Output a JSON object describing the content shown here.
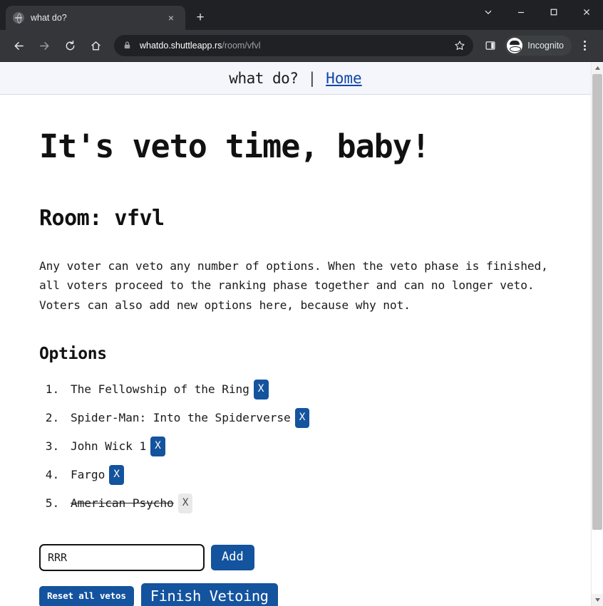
{
  "browser": {
    "tab": {
      "title": "what do?",
      "favicon": "globe-icon",
      "close_label": "×"
    },
    "new_tab_label": "+",
    "window_controls": {
      "tab_search": "chevron-down-icon",
      "minimize": "minimize-icon",
      "maximize": "maximize-icon",
      "close": "close-icon"
    },
    "nav": {
      "back": "back-arrow-icon",
      "forward": "forward-arrow-icon",
      "reload": "reload-icon",
      "home": "home-icon"
    },
    "omnibox": {
      "lock": "lock-icon",
      "url_host": "whatdo.shuttleapp.rs",
      "url_path": "/room/vfvl",
      "bookmark": "star-icon"
    },
    "side_panel": "side-panel-icon",
    "incognito": {
      "label": "Incognito",
      "icon": "incognito-icon"
    },
    "menu": "three-dot-menu-icon"
  },
  "site": {
    "brand": "what do?",
    "separator": "|",
    "home_link": "Home"
  },
  "page": {
    "title": "It's veto time, baby!",
    "room_heading": "Room: vfvl",
    "blurb": "Any voter can veto any number of options. When the veto phase is finished, all voters proceed to the ranking phase together and can no longer veto. Voters can also add new options here, because why not.",
    "options_heading": "Options",
    "options": [
      {
        "label": "The Fellowship of the Ring",
        "veto_label": "X",
        "vetoed": false
      },
      {
        "label": "Spider-Man: Into the Spiderverse",
        "veto_label": "X",
        "vetoed": false
      },
      {
        "label": "John Wick 1",
        "veto_label": "X",
        "vetoed": false
      },
      {
        "label": "Fargo",
        "veto_label": "X",
        "vetoed": false
      },
      {
        "label": "American Psycho",
        "veto_label": "X",
        "vetoed": true
      }
    ],
    "add_input_value": "RRR",
    "add_input_placeholder": "",
    "add_button": "Add",
    "reset_button": "Reset all vetos",
    "finish_button": "Finish Vetoing"
  },
  "colors": {
    "primary_blue": "#14539e",
    "link_blue": "#1146a8",
    "disabled_gray": "#e9e9e9",
    "nav_bg": "#f4f6fb",
    "chrome_dark": "#202124",
    "chrome_toolbar": "#35363a"
  }
}
